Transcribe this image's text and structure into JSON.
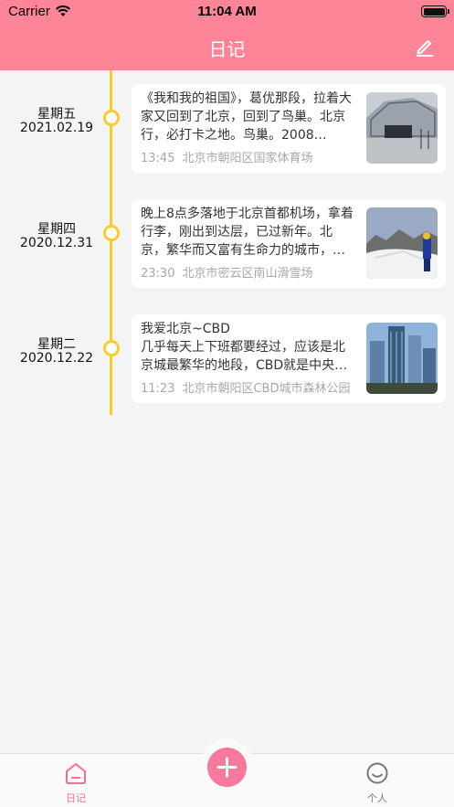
{
  "status_bar": {
    "carrier": "Carrier",
    "time": "11:04 AM"
  },
  "header": {
    "title": "日记"
  },
  "entries": [
    {
      "weekday": "星期五",
      "date": "2021.02.19",
      "text": "《我和我的祖国》，葛优那段，拉着大家又回到了北京，回到了鸟巢。北京行，必打卡之地。鸟巢。2008…",
      "time": "13:45",
      "location": "北京市朝阳区国家体育场"
    },
    {
      "weekday": "星期四",
      "date": "2020.12.31",
      "text": "晚上8点多落地于北京首都机场，拿着行李，刚出到达层，已过新年。北京，繁华而又富有生命力的城市，…",
      "time": "23:30",
      "location": "北京市密云区南山滑雪场"
    },
    {
      "weekday": "星期二",
      "date": "2020.12.22",
      "text": "我爱北京~CBD\n几乎每天上下班都要经过，应该是北京城最繁华的地段，CBD就是中央…",
      "time": "11:23",
      "location": "北京市朝阳区CBD城市森林公园"
    }
  ],
  "tabbar": {
    "diary_label": "日记",
    "me_label": "个人"
  },
  "colors": {
    "header": "#fd8597",
    "timeline": "#f6cd2b",
    "accent": "#f26f8c"
  }
}
